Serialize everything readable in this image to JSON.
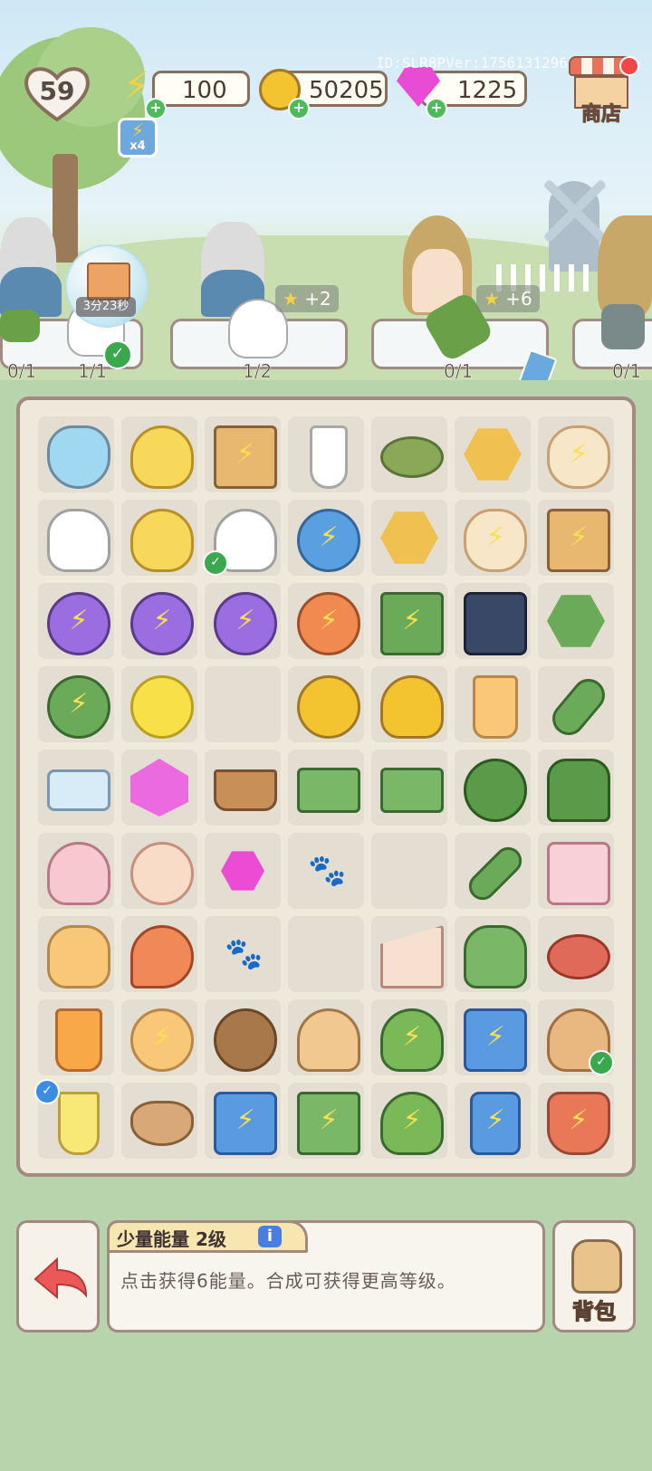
{
  "header": {
    "level": "59",
    "energy": "100",
    "coins": "50205",
    "gems": "1225",
    "id_text": "ID:SLR8PVer:1756131296",
    "shop_label": "商店",
    "boost_label": "x4"
  },
  "orders": [
    {
      "progress": "0/1"
    },
    {
      "progress": "1/1",
      "timer": "3分23秒"
    },
    {
      "progress": "1/2",
      "reward": "+2"
    },
    {
      "progress": "0/1",
      "reward": "+6"
    },
    {
      "progress": "0/1"
    }
  ],
  "board": {
    "rows": [
      [
        "bowl-of-candy",
        "rubber-duck",
        "meat-gift-box",
        "paper-cup",
        "green-bean",
        "infinity-hex-token",
        "cat-plush-energy"
      ],
      [
        "goose",
        "rubber-duck",
        "swan-pair",
        "blue-energy-coin",
        "hourglass-hex-token",
        "cat-plush-energy",
        "juice-gift-box"
      ],
      [
        "purple-energy-coin",
        "purple-energy-coin",
        "purple-energy-coin",
        "orange-energy-coin",
        "green-toolbox-energy",
        "dark-clip",
        "green-hourglass-hex"
      ],
      [
        "green-energy-coin",
        "lemon",
        "empty",
        "gold-coins-small",
        "gold-coins-pile",
        "orange-juice-glass",
        "garden-trowel"
      ],
      [
        "ice-tray",
        "pink-gems",
        "sprout-pot",
        "green-toolbox-open",
        "green-toolbox",
        "green-helmet-gloves",
        "green-armor-gloves"
      ],
      [
        "ice-cream-sundae",
        "shell",
        "pink-hexagon",
        "paw-slot",
        "empty",
        "screwdriver",
        "strawberry-cake"
      ],
      [
        "fruit-parfait",
        "shrimp",
        "paw-slot",
        "empty",
        "strawberry-cake-slice",
        "green-gloves",
        "raw-meat"
      ],
      [
        "orange-drink",
        "beach-picnic-energy",
        "coconut-drink",
        "strawberry-tart",
        "tree-energy",
        "blue-machine-energy",
        "cat-bowl-yarn"
      ],
      [
        "lemonade-glass",
        "cat-basket",
        "blue-machine-energy",
        "green-case-energy",
        "tree-energy",
        "blue-fridge-energy",
        "strawberry-pot-energy"
      ]
    ],
    "checks": [
      [
        1,
        2
      ],
      [
        7,
        6
      ],
      [
        8,
        0
      ]
    ]
  },
  "info": {
    "title": "少量能量 2级",
    "info_icon": "i",
    "description": "点击获得6能量。合成可获得更高等级。"
  },
  "bag_label": "背包",
  "colors": {
    "board_border": "#a28a80",
    "energy_purple": "#9a6ee0",
    "coin_gold": "#f4c430",
    "gem_pink": "#e84cd4",
    "check_green": "#3aa84c"
  }
}
